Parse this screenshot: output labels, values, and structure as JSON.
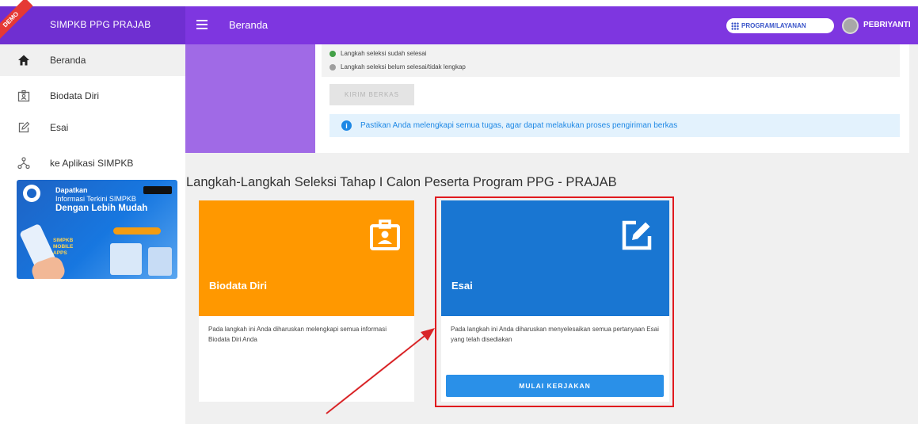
{
  "app": {
    "brand_title": "SIMPKB PPG PRAJAB",
    "demo_badge": "DEMO",
    "page_title": "Beranda",
    "program_button": "PROGRAM/LAYANAN",
    "user_name": "PEBRIYANTI"
  },
  "sidebar": {
    "items": [
      {
        "label": "Beranda",
        "icon": "home-icon"
      },
      {
        "label": "Biodata Diri",
        "icon": "id-card-icon"
      },
      {
        "label": "Esai",
        "icon": "edit-icon"
      },
      {
        "label": "ke Aplikasi SIMPKB",
        "icon": "network-icon"
      }
    ],
    "promo": {
      "line1": "Dapatkan",
      "line2": "Informasi Terkini SIMPKB",
      "line3": "Dengan Lebih Mudah",
      "apps_label": "SIMPKB MOBILE APPS"
    }
  },
  "status": {
    "legend": [
      {
        "text": "Langkah seleksi sudah selesai",
        "color": "#43a047"
      },
      {
        "text": "Langkah seleksi belum selesai/tidak lengkap",
        "color": "#9e9e9e"
      }
    ],
    "send_button": "KIRIM BERKAS",
    "info": "Pastikan Anda melengkapi semua tugas, agar dapat melakukan proses pengiriman berkas"
  },
  "section": {
    "heading": "Langkah-Langkah Seleksi Tahap I Calon Peserta Program PPG - PRAJAB"
  },
  "cards": [
    {
      "title": "Biodata Diri",
      "description": "Pada langkah ini Anda diharuskan melengkapi semua informasi Biodata Diri Anda",
      "color": "#ff9800",
      "icon": "id-badge-icon"
    },
    {
      "title": "Esai",
      "description": "Pada langkah ini Anda diharuskan menyelesaikan semua pertanyaan Esai yang telah disediakan",
      "color": "#1976d2",
      "icon": "edit-square-icon",
      "button": "MULAI KERJAKAN"
    }
  ]
}
